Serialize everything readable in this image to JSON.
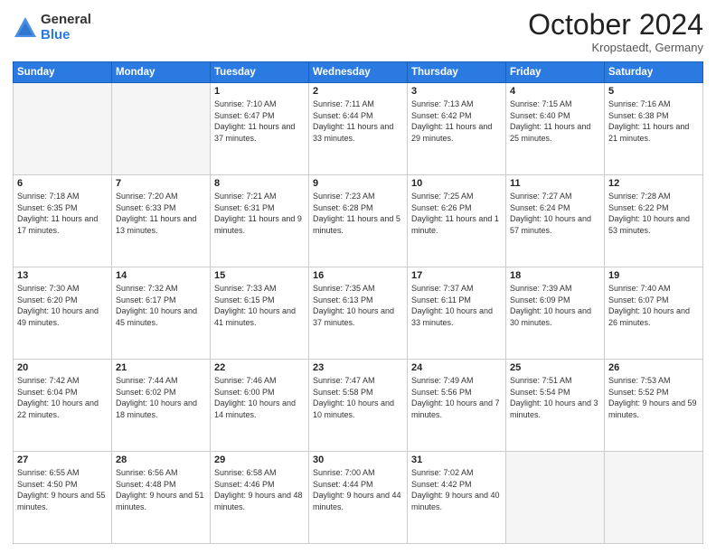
{
  "header": {
    "logo_general": "General",
    "logo_blue": "Blue",
    "month_title": "October 2024",
    "location": "Kropstaedt, Germany"
  },
  "weekdays": [
    "Sunday",
    "Monday",
    "Tuesday",
    "Wednesday",
    "Thursday",
    "Friday",
    "Saturday"
  ],
  "weeks": [
    [
      {
        "day": "",
        "detail": ""
      },
      {
        "day": "",
        "detail": ""
      },
      {
        "day": "1",
        "detail": "Sunrise: 7:10 AM\nSunset: 6:47 PM\nDaylight: 11 hours and 37 minutes."
      },
      {
        "day": "2",
        "detail": "Sunrise: 7:11 AM\nSunset: 6:44 PM\nDaylight: 11 hours and 33 minutes."
      },
      {
        "day": "3",
        "detail": "Sunrise: 7:13 AM\nSunset: 6:42 PM\nDaylight: 11 hours and 29 minutes."
      },
      {
        "day": "4",
        "detail": "Sunrise: 7:15 AM\nSunset: 6:40 PM\nDaylight: 11 hours and 25 minutes."
      },
      {
        "day": "5",
        "detail": "Sunrise: 7:16 AM\nSunset: 6:38 PM\nDaylight: 11 hours and 21 minutes."
      }
    ],
    [
      {
        "day": "6",
        "detail": "Sunrise: 7:18 AM\nSunset: 6:35 PM\nDaylight: 11 hours and 17 minutes."
      },
      {
        "day": "7",
        "detail": "Sunrise: 7:20 AM\nSunset: 6:33 PM\nDaylight: 11 hours and 13 minutes."
      },
      {
        "day": "8",
        "detail": "Sunrise: 7:21 AM\nSunset: 6:31 PM\nDaylight: 11 hours and 9 minutes."
      },
      {
        "day": "9",
        "detail": "Sunrise: 7:23 AM\nSunset: 6:28 PM\nDaylight: 11 hours and 5 minutes."
      },
      {
        "day": "10",
        "detail": "Sunrise: 7:25 AM\nSunset: 6:26 PM\nDaylight: 11 hours and 1 minute."
      },
      {
        "day": "11",
        "detail": "Sunrise: 7:27 AM\nSunset: 6:24 PM\nDaylight: 10 hours and 57 minutes."
      },
      {
        "day": "12",
        "detail": "Sunrise: 7:28 AM\nSunset: 6:22 PM\nDaylight: 10 hours and 53 minutes."
      }
    ],
    [
      {
        "day": "13",
        "detail": "Sunrise: 7:30 AM\nSunset: 6:20 PM\nDaylight: 10 hours and 49 minutes."
      },
      {
        "day": "14",
        "detail": "Sunrise: 7:32 AM\nSunset: 6:17 PM\nDaylight: 10 hours and 45 minutes."
      },
      {
        "day": "15",
        "detail": "Sunrise: 7:33 AM\nSunset: 6:15 PM\nDaylight: 10 hours and 41 minutes."
      },
      {
        "day": "16",
        "detail": "Sunrise: 7:35 AM\nSunset: 6:13 PM\nDaylight: 10 hours and 37 minutes."
      },
      {
        "day": "17",
        "detail": "Sunrise: 7:37 AM\nSunset: 6:11 PM\nDaylight: 10 hours and 33 minutes."
      },
      {
        "day": "18",
        "detail": "Sunrise: 7:39 AM\nSunset: 6:09 PM\nDaylight: 10 hours and 30 minutes."
      },
      {
        "day": "19",
        "detail": "Sunrise: 7:40 AM\nSunset: 6:07 PM\nDaylight: 10 hours and 26 minutes."
      }
    ],
    [
      {
        "day": "20",
        "detail": "Sunrise: 7:42 AM\nSunset: 6:04 PM\nDaylight: 10 hours and 22 minutes."
      },
      {
        "day": "21",
        "detail": "Sunrise: 7:44 AM\nSunset: 6:02 PM\nDaylight: 10 hours and 18 minutes."
      },
      {
        "day": "22",
        "detail": "Sunrise: 7:46 AM\nSunset: 6:00 PM\nDaylight: 10 hours and 14 minutes."
      },
      {
        "day": "23",
        "detail": "Sunrise: 7:47 AM\nSunset: 5:58 PM\nDaylight: 10 hours and 10 minutes."
      },
      {
        "day": "24",
        "detail": "Sunrise: 7:49 AM\nSunset: 5:56 PM\nDaylight: 10 hours and 7 minutes."
      },
      {
        "day": "25",
        "detail": "Sunrise: 7:51 AM\nSunset: 5:54 PM\nDaylight: 10 hours and 3 minutes."
      },
      {
        "day": "26",
        "detail": "Sunrise: 7:53 AM\nSunset: 5:52 PM\nDaylight: 9 hours and 59 minutes."
      }
    ],
    [
      {
        "day": "27",
        "detail": "Sunrise: 6:55 AM\nSunset: 4:50 PM\nDaylight: 9 hours and 55 minutes."
      },
      {
        "day": "28",
        "detail": "Sunrise: 6:56 AM\nSunset: 4:48 PM\nDaylight: 9 hours and 51 minutes."
      },
      {
        "day": "29",
        "detail": "Sunrise: 6:58 AM\nSunset: 4:46 PM\nDaylight: 9 hours and 48 minutes."
      },
      {
        "day": "30",
        "detail": "Sunrise: 7:00 AM\nSunset: 4:44 PM\nDaylight: 9 hours and 44 minutes."
      },
      {
        "day": "31",
        "detail": "Sunrise: 7:02 AM\nSunset: 4:42 PM\nDaylight: 9 hours and 40 minutes."
      },
      {
        "day": "",
        "detail": ""
      },
      {
        "day": "",
        "detail": ""
      }
    ]
  ]
}
